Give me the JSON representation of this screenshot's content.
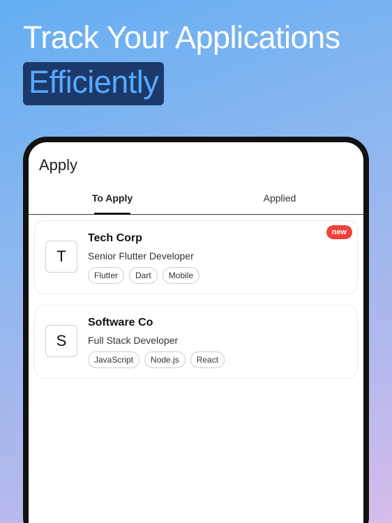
{
  "promo": {
    "headline": "Track Your Applications",
    "highlight": "Efficiently"
  },
  "app": {
    "title": "Apply",
    "tabs": [
      {
        "label": "To Apply",
        "active": true
      },
      {
        "label": "Applied",
        "active": false
      }
    ],
    "jobs": [
      {
        "initial": "T",
        "company": "Tech Corp",
        "role": "Senior Flutter Developer",
        "tags": [
          "Flutter",
          "Dart",
          "Mobile"
        ],
        "badge": "new"
      },
      {
        "initial": "S",
        "company": "Software Co",
        "role": "Full Stack Developer",
        "tags": [
          "JavaScript",
          "Node.js",
          "React"
        ]
      }
    ]
  },
  "colors": {
    "badge": "#f0413b",
    "highlight_bg": "#1b3a6b",
    "highlight_text": "#5aa9ff"
  }
}
